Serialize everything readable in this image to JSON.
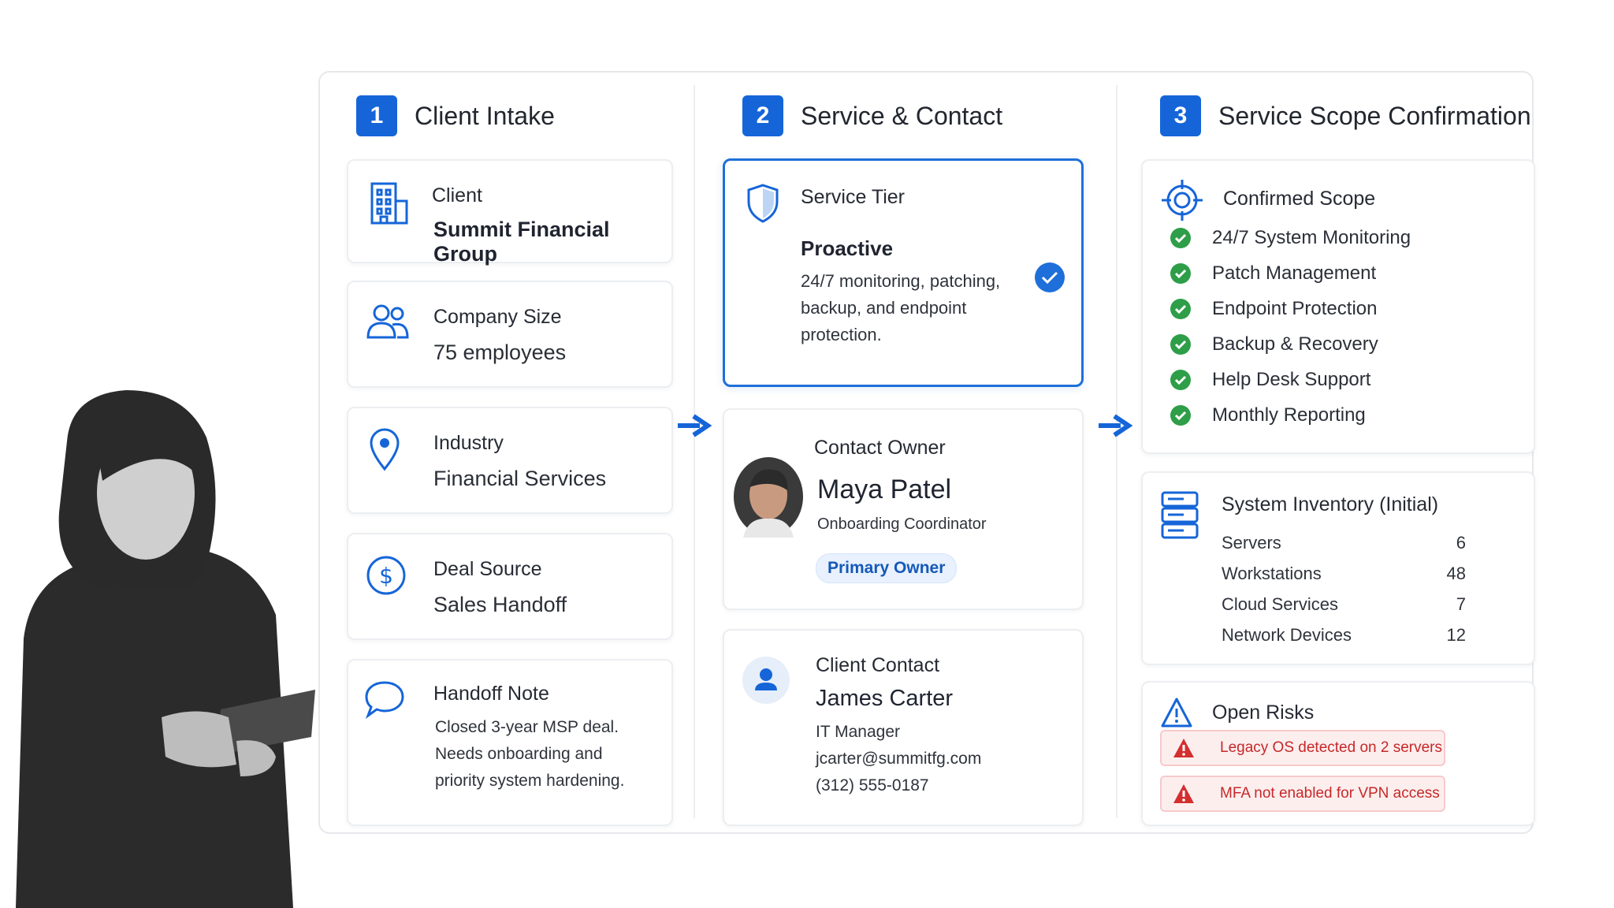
{
  "col1": {
    "step": "1",
    "title": "Client Intake",
    "client": {
      "label": "Client",
      "value": "Summit Financial Group"
    },
    "company_size": {
      "label": "Company Size",
      "value": "75 employees"
    },
    "industry": {
      "label": "Industry",
      "value": "Financial Services"
    },
    "deal_source": {
      "label": "Deal Source",
      "value": "Sales Handoff"
    },
    "handoff_note": {
      "label": "Handoff Note",
      "lines": [
        "Closed 3-year MSP deal.",
        "Needs onboarding and",
        "priority system hardening."
      ]
    }
  },
  "col2": {
    "step": "2",
    "title": "Service & Contact",
    "service_tier": {
      "label": "Service Tier",
      "name": "Proactive",
      "lines": [
        "24/7 monitoring, patching,",
        "backup, and endpoint",
        "protection."
      ]
    },
    "contact_owner": {
      "label": "Contact Owner",
      "name": "Maya Patel",
      "role": "Onboarding Coordinator",
      "badge": "Primary Owner"
    },
    "client_contact": {
      "label": "Client Contact",
      "name": "James Carter",
      "title": "IT Manager",
      "email": "jcarter@summitfg.com",
      "phone": "(312) 555-0187"
    }
  },
  "col3": {
    "step": "3",
    "title": "Service Scope Confirmation",
    "confirmed_scope": {
      "label": "Confirmed Scope",
      "items": [
        "24/7 System Monitoring",
        "Patch Management",
        "Endpoint Protection",
        "Backup & Recovery",
        "Help Desk Support",
        "Monthly Reporting"
      ]
    },
    "inventory": {
      "label": "System Inventory (Initial)",
      "rows": [
        {
          "name": "Servers",
          "count": "6"
        },
        {
          "name": "Workstations",
          "count": "48"
        },
        {
          "name": "Cloud Services",
          "count": "7"
        },
        {
          "name": "Network Devices",
          "count": "12"
        }
      ]
    },
    "risks": {
      "label": "Open Risks",
      "items": [
        "Legacy OS detected on 2 servers",
        "MFA not enabled for VPN access"
      ]
    }
  },
  "colors": {
    "accent": "#1565d8",
    "success": "#2e9e48",
    "danger": "#d32f2f"
  },
  "icons": [
    "building-icon",
    "people-icon",
    "location-pin-icon",
    "dollar-icon",
    "chat-bubble-icon",
    "shield-icon",
    "check-circle-icon",
    "user-icon",
    "target-icon",
    "server-stack-icon",
    "warning-icon",
    "arrow-right-icon"
  ]
}
